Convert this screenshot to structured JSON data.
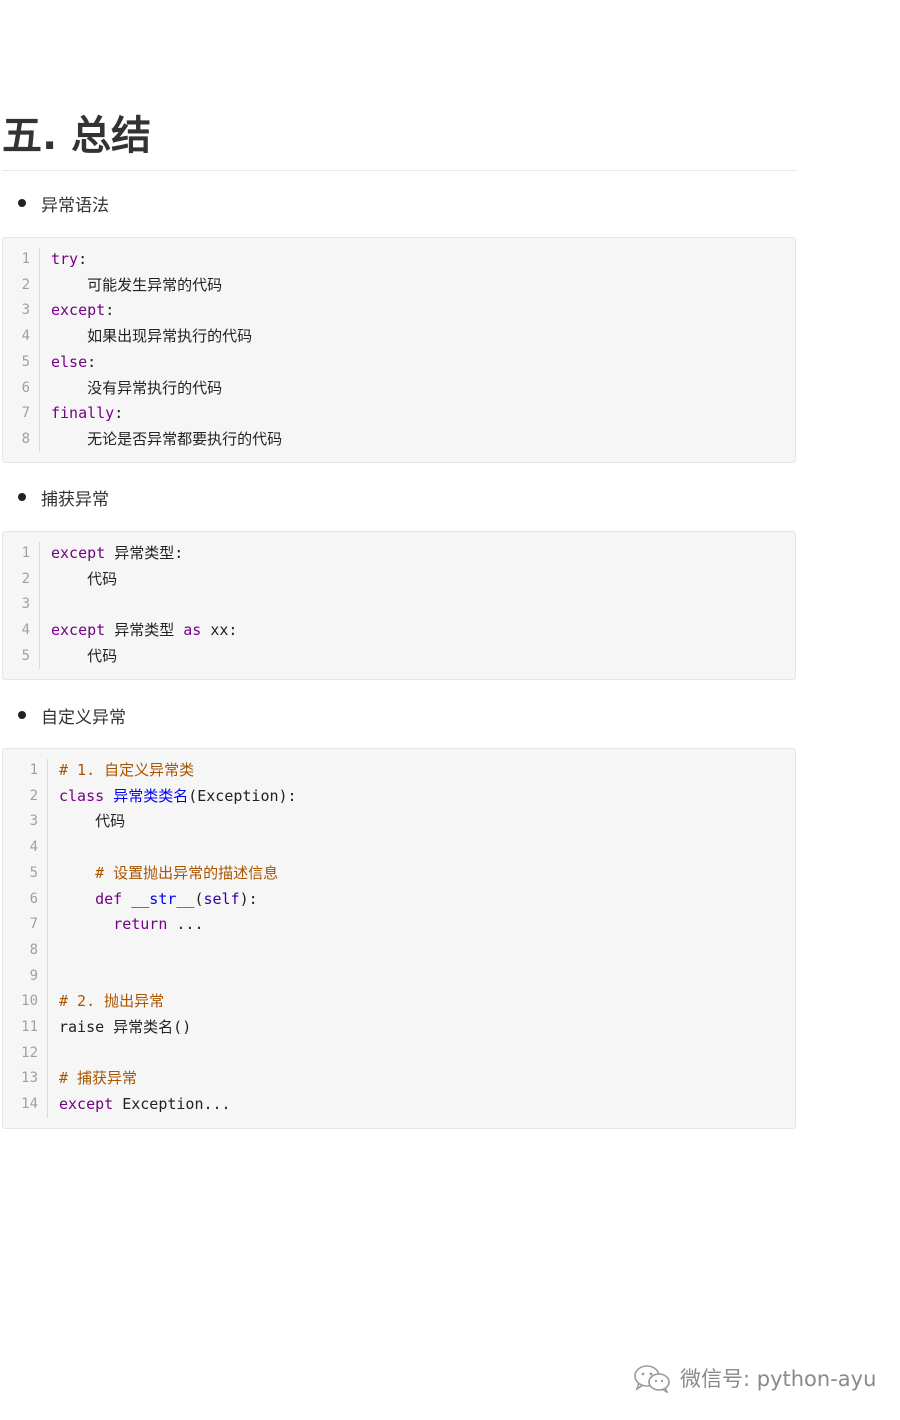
{
  "title": "五. 总结",
  "sections": [
    {
      "label": "异常语法",
      "lines": [
        [
          [
            "kw",
            "try"
          ],
          [
            "p",
            ":"
          ]
        ],
        [
          [
            "p",
            "    可能发生异常的代码"
          ]
        ],
        [
          [
            "kw",
            "except"
          ],
          [
            "p",
            ":"
          ]
        ],
        [
          [
            "p",
            "    如果出现异常执行的代码"
          ]
        ],
        [
          [
            "kw",
            "else"
          ],
          [
            "p",
            ":"
          ]
        ],
        [
          [
            "p",
            "    没有异常执行的代码"
          ]
        ],
        [
          [
            "kw",
            "finally"
          ],
          [
            "p",
            ":"
          ]
        ],
        [
          [
            "p",
            "    无论是否异常都要执行的代码"
          ]
        ]
      ]
    },
    {
      "label": "捕获异常",
      "lines": [
        [
          [
            "kw",
            "except"
          ],
          [
            "p",
            " 异常类型:"
          ]
        ],
        [
          [
            "p",
            "    代码"
          ]
        ],
        [
          [
            "p",
            ""
          ]
        ],
        [
          [
            "kw",
            "except"
          ],
          [
            "p",
            " 异常类型 "
          ],
          [
            "kw",
            "as"
          ],
          [
            "p",
            " xx:"
          ]
        ],
        [
          [
            "p",
            "    代码"
          ]
        ]
      ]
    },
    {
      "label": "自定义异常",
      "lines": [
        [
          [
            "comment",
            "# 1. 自定义异常类"
          ]
        ],
        [
          [
            "kw",
            "class"
          ],
          [
            "p",
            " "
          ],
          [
            "def",
            "异常类类名"
          ],
          [
            "p",
            "(Exception):"
          ]
        ],
        [
          [
            "p",
            "    代码"
          ]
        ],
        [
          [
            "p",
            ""
          ]
        ],
        [
          [
            "p",
            "    "
          ],
          [
            "comment",
            "# 设置抛出异常的描述信息"
          ]
        ],
        [
          [
            "p",
            "    "
          ],
          [
            "kw",
            "def"
          ],
          [
            "p",
            " "
          ],
          [
            "def",
            "__str__"
          ],
          [
            "p",
            "("
          ],
          [
            "var",
            "self"
          ],
          [
            "p",
            "):"
          ]
        ],
        [
          [
            "p",
            "      "
          ],
          [
            "kw",
            "return"
          ],
          [
            "p",
            " ..."
          ]
        ],
        [
          [
            "p",
            ""
          ]
        ],
        [
          [
            "p",
            ""
          ]
        ],
        [
          [
            "comment",
            "# 2. 抛出异常"
          ]
        ],
        [
          [
            "p",
            "raise 异常类名()"
          ]
        ],
        [
          [
            "p",
            ""
          ]
        ],
        [
          [
            "comment",
            "# 捕获异常"
          ]
        ],
        [
          [
            "kw",
            "except"
          ],
          [
            "p",
            " Exception..."
          ]
        ]
      ]
    }
  ],
  "watermark": {
    "icon": "wechat-icon",
    "text": "微信号: python-ayu"
  }
}
